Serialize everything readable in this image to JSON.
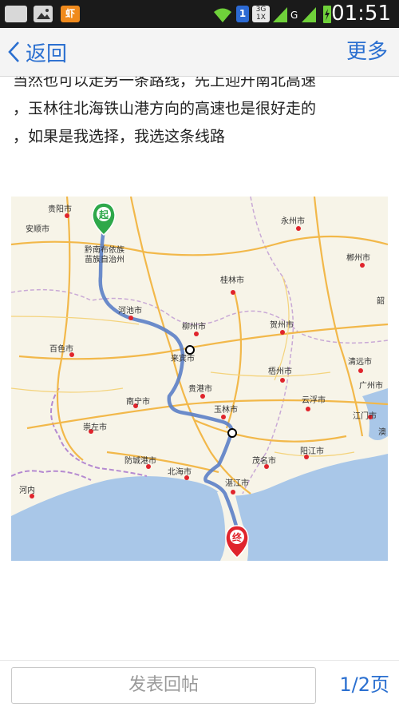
{
  "status_bar": {
    "clock": "01:51",
    "network_badge": "3G\n1X",
    "sim_badge": "1",
    "signal_g": "G",
    "notif_app": "虾",
    "icons": [
      "photo-notification-icon",
      "image-icon",
      "app-notification-icon",
      "wifi-icon",
      "signal-icon",
      "battery-charging-icon"
    ]
  },
  "header": {
    "back_label": "返回",
    "more_label": "更多"
  },
  "post": {
    "lines": [
      "当然也可以走另一条路线，先上迎升南北高速",
      "，玉林往北海铁山港方向的高速也是很好走的",
      "，如果是我选择，我选这条线路"
    ]
  },
  "map": {
    "start_marker": "起",
    "end_marker": "终",
    "cities": {
      "guiyang": "贵阳市",
      "anshun": "安顺市",
      "yongzhou": "永州市",
      "chenzhou": "郴州市",
      "qiannan_1": "黔南布依族",
      "qiannan_2": "苗族自治州",
      "guilin": "桂林市",
      "hechi": "河池市",
      "liuzhou": "柳州市",
      "hezhou": "贺州市",
      "baise": "百色市",
      "laibin": "来宾市",
      "qingyuan": "清远市",
      "wuzhou": "梧州市",
      "guigang": "贵港市",
      "guangzhou": "广州市",
      "yunfu": "云浮市",
      "nanning": "南宁市",
      "yulin": "玉林市",
      "jiangmen": "江门市",
      "chongzuo": "崇左市",
      "yangjiang": "阳江市",
      "fangchenggang": "防城港市",
      "maoming": "茂名市",
      "beihai": "北海市",
      "zhanjiang": "湛江市",
      "hanei": "河内",
      "shao": "韶",
      "ao": "澳"
    }
  },
  "bottom": {
    "reply_placeholder": "发表回帖",
    "page_indicator": "1/2页"
  },
  "colors": {
    "accent": "#2a6fd0",
    "route": "#5b7fc6",
    "start_marker": "#2ea84a",
    "end_marker": "#e0242c",
    "sea": "#a9c7e8"
  }
}
